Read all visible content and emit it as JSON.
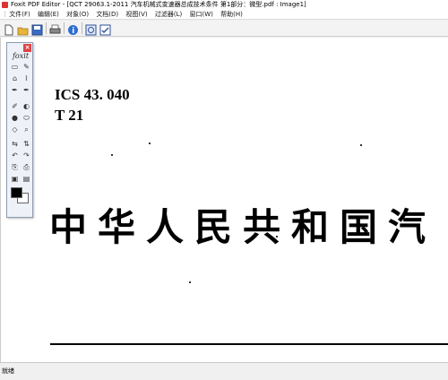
{
  "window": {
    "title": "Foxit PDF Editor - [QCT 29063.1-2011 汽车机械式变速器总成技术条件 第1部分：微型.pdf : Image1]"
  },
  "menu": [
    "文件(F)",
    "编辑(E)",
    "对象(O)",
    "文档(D)",
    "视图(V)",
    "过滤器(L)",
    "窗口(W)",
    "帮助(H)"
  ],
  "toolbar": {
    "buttons": [
      "new-doc-icon",
      "open-folder-icon",
      "save-icon",
      "print-icon",
      "info-icon",
      "select-icon",
      "checkbox-icon"
    ],
    "colors": {
      "open": "#e8b43a",
      "save": "#3b6bc4",
      "print": "#666666",
      "info": "#2f6fd1"
    }
  },
  "palette": {
    "logo": "foxit",
    "close": "×",
    "tools": [
      [
        "▭",
        "✎"
      ],
      [
        "⌂",
        "⌇"
      ],
      [
        "✒",
        "✒"
      ],
      [
        "✐",
        "◐"
      ],
      [
        "●",
        "⬭"
      ],
      [
        "◇",
        "⌕"
      ],
      [
        "⇆",
        "⇅"
      ],
      [
        "↶",
        "↷"
      ],
      [
        "⎘",
        "⎙"
      ],
      [
        "▣",
        "▤"
      ]
    ]
  },
  "document": {
    "ics": "ICS 43. 040",
    "category": "T 21",
    "heading": "中华人民共和国汽"
  },
  "status": {
    "text": "就绪"
  }
}
